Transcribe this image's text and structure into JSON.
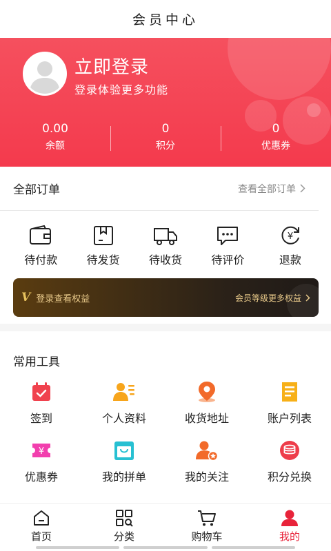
{
  "header": {
    "title": "会员中心"
  },
  "hero": {
    "login_title": "立即登录",
    "login_subtitle": "登录体验更多功能",
    "stats": [
      {
        "value": "0.00",
        "label": "余额"
      },
      {
        "value": "0",
        "label": "积分"
      },
      {
        "value": "0",
        "label": "优惠券"
      }
    ]
  },
  "orders": {
    "title": "全部订单",
    "view_all": "查看全部订单",
    "items": [
      {
        "label": "待付款",
        "icon": "wallet-icon"
      },
      {
        "label": "待发货",
        "icon": "package-icon"
      },
      {
        "label": "待收货",
        "icon": "truck-icon"
      },
      {
        "label": "待评价",
        "icon": "comment-icon"
      },
      {
        "label": "退款",
        "icon": "refund-icon"
      }
    ]
  },
  "vip_banner": {
    "mark": "V",
    "left_text": "登录查看权益",
    "right_text": "会员等级更多权益"
  },
  "tools": {
    "title": "常用工具",
    "items": [
      {
        "label": "签到",
        "icon": "calendar-check-icon",
        "color": "#f0424e"
      },
      {
        "label": "个人资料",
        "icon": "profile-icon",
        "color": "#f7a51c"
      },
      {
        "label": "收货地址",
        "icon": "location-icon",
        "color": "#f26a2a"
      },
      {
        "label": "账户列表",
        "icon": "document-list-icon",
        "color": "#f7b018"
      },
      {
        "label": "优惠券",
        "icon": "coupon-icon",
        "color": "#f23fae"
      },
      {
        "label": "我的拼单",
        "icon": "shopping-bag-icon",
        "color": "#27c0d2"
      },
      {
        "label": "我的关注",
        "icon": "user-star-icon",
        "color": "#f26a2a"
      },
      {
        "label": "积分兑换",
        "icon": "coins-icon",
        "color": "#ee3d4a"
      }
    ]
  },
  "tabbar": {
    "items": [
      {
        "label": "首页",
        "icon": "home-icon",
        "active": false
      },
      {
        "label": "分类",
        "icon": "category-icon",
        "active": false
      },
      {
        "label": "购物车",
        "icon": "cart-icon",
        "active": false
      },
      {
        "label": "我的",
        "icon": "user-icon",
        "active": true
      }
    ],
    "active_color": "#e8233a"
  },
  "colors": {
    "brand": "#f4434f",
    "vip_gold": "#e8c98a"
  }
}
